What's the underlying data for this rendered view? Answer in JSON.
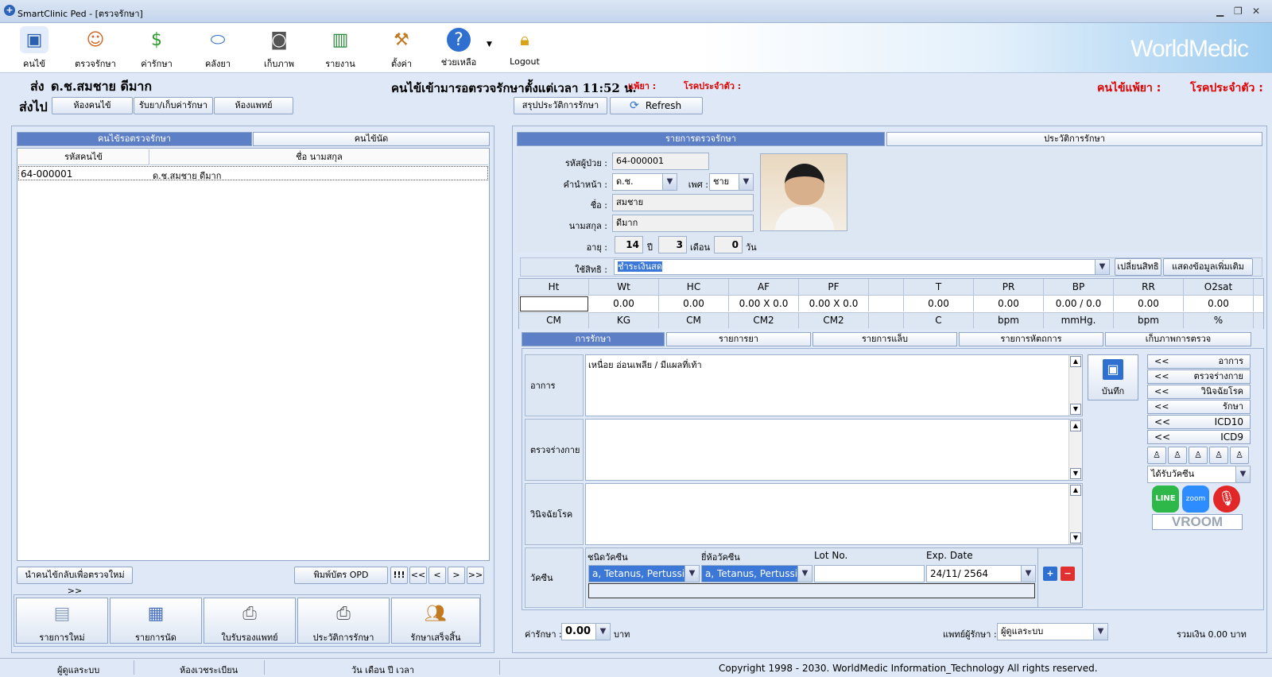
{
  "window": {
    "title": "SmartClinic Ped - [ตรวจรักษา]"
  },
  "toolbar": {
    "items": [
      {
        "label": "คนไข้",
        "icon": "patient-book-icon"
      },
      {
        "label": "ตรวจรักษา",
        "icon": "doctor-icon"
      },
      {
        "label": "ค่ารักษา",
        "icon": "money-icon"
      },
      {
        "label": "คลังยา",
        "icon": "pill-icon"
      },
      {
        "label": "เก็บภาพ",
        "icon": "camera-icon"
      },
      {
        "label": "รายงาน",
        "icon": "bar-chart-icon"
      },
      {
        "label": "ตั้งค่า",
        "icon": "tools-icon"
      },
      {
        "label": "ช่วยเหลือ",
        "icon": "help-icon"
      },
      {
        "label": "Logout",
        "icon": "lock-icon"
      }
    ],
    "brand": "WorldMedic"
  },
  "header": {
    "send_label": "ส่ง",
    "patient_name": "ด.ช.สมชาย ดีมาก",
    "waiting_text": "คนไข้เข้ามารอตรวจรักษาตั้งแต่เวลา 11:52 น.",
    "allergy_small": "แพ้ยา :",
    "chronic_small": "โรคประจำตัว :",
    "allergy_big": "คนไข้แพ้ยา :",
    "chronic_big": "โรคประจำตัว :",
    "sendto_label": "ส่งไป",
    "sendto_buttons": [
      "ห้องคนไข้",
      "รับยา/เก็บค่ารักษา",
      "ห้องแพทย์"
    ],
    "summary_button": "สรุปประวัติการรักษา",
    "refresh_button": "Refresh"
  },
  "left": {
    "tabs": [
      "คนไข้รอตรวจรักษา",
      "คนไข้นัด"
    ],
    "columns": [
      "รหัสคนไข้",
      "ชื่อ นามสกุล"
    ],
    "rows": [
      {
        "id": "64-000001",
        "name": "ด.ช.สมชาย ดีมาก"
      }
    ],
    "back_button": "นำคนไข้กลับเพื่อตรวจใหม่ >>",
    "print_button": "พิมพ์บัตร OPD",
    "nav": [
      "!!!",
      "<<",
      "<",
      ">",
      ">>"
    ],
    "bottom_buttons": [
      {
        "label": "รายการใหม่",
        "icon": "new-document-icon"
      },
      {
        "label": "รายการนัด",
        "icon": "calendar-icon"
      },
      {
        "label": "ใบรับรองแพทย์",
        "icon": "printer-icon"
      },
      {
        "label": "ประวัติการรักษา",
        "icon": "printer-check-icon"
      },
      {
        "label": "รักษาเสร็จสิ้น",
        "icon": "users-check-icon"
      }
    ]
  },
  "right": {
    "tabs": [
      "รายการตรวจรักษา",
      "ประวัติการรักษา"
    ],
    "patient": {
      "hn_label": "รหัสผู้ป่วย :",
      "hn": "64-000001",
      "prefix_label": "คำนำหน้า :",
      "prefix": "ด.ช.",
      "sex_label": "เพศ :",
      "sex": "ชาย",
      "fname_label": "ชื่อ :",
      "fname": "สมชาย",
      "lname_label": "นามสกุล :",
      "lname": "ดีมาก",
      "age_label": "อายุ :",
      "age_y": "14",
      "y_unit": "ปี",
      "age_m": "3",
      "m_unit": "เดือน",
      "age_d": "0",
      "d_unit": "วัน"
    },
    "rights_label": "ใช้สิทธิ :",
    "rights_value": "ชำระเงินสด",
    "change_rights": "เปลี่ยนสิทธิ",
    "more_info": "แสดงข้อมูลเพิ่มเติม",
    "vitals": {
      "headers": [
        "Ht",
        "Wt",
        "HC",
        "AF",
        "PF",
        "",
        "T",
        "PR",
        "BP",
        "RR",
        "O2sat"
      ],
      "values": [
        "",
        "0.00",
        "0.00",
        "0.00 X 0.0",
        "0.00 X 0.0",
        "",
        "0.00",
        "0.00",
        "0.00 / 0.0",
        "0.00",
        "0.00"
      ],
      "units": [
        "CM",
        "KG",
        "CM",
        "CM2",
        "CM2",
        "",
        "C",
        "bpm",
        "mmHg.",
        "bpm",
        "%"
      ]
    },
    "subtabs": [
      "การรักษา",
      "รายการยา",
      "รายการแล็บ",
      "รายการหัตถการ",
      "เก็บภาพการตรวจ"
    ],
    "fields": {
      "symptom_label": "อาการ",
      "symptom_value": "เหนื่อย อ่อนเพลีย / มีแผลที่เท้า",
      "exam_label": "ตรวจร่างกาย",
      "diag_label": "วินิจฉัยโรค",
      "vaccine_label": "วัคซีน"
    },
    "save_button": "บันทึก",
    "vaccine": {
      "headers": [
        "ชนิดวัคซีน",
        "ยี่ห้อวัคซีน",
        "Lot No.",
        "Exp. Date"
      ],
      "type": "a, Tetanus, Pertussis",
      "brand": "a, Tetanus, Pertussis",
      "lot": "",
      "exp": "24/11/ 2564"
    },
    "side": {
      "buttons": [
        "อาการ",
        "ตรวจร่างกาย",
        "วินิจฉัยโรค",
        "รักษา",
        "ICD10",
        "ICD9"
      ],
      "arrow": "<<",
      "vaccine_select": "ได้รับวัคซีน",
      "apps": [
        "LINE",
        "zoom"
      ],
      "vroom": "VROOM"
    },
    "fee_label": "ค่ารักษา :",
    "fee_value": "0.00",
    "baht": "บาท",
    "doctor_label": "แพทย์ผู้รักษา :",
    "doctor_value": "ผู้ดูแลระบบ",
    "total": "รวมเงิน 0.00 บาท"
  },
  "status": {
    "user": "ผู้ดูแลระบบ",
    "room": "ห้องเวชระเบียน",
    "date": "วัน เดือน ปี เวลา",
    "copyright": "Copyright 1998 - 2030. WorldMedic Information_Technology All rights reserved."
  },
  "colors": {
    "tab_active": "#5d7fc6",
    "alert": "#e00000",
    "panel": "#dfe8f6"
  }
}
